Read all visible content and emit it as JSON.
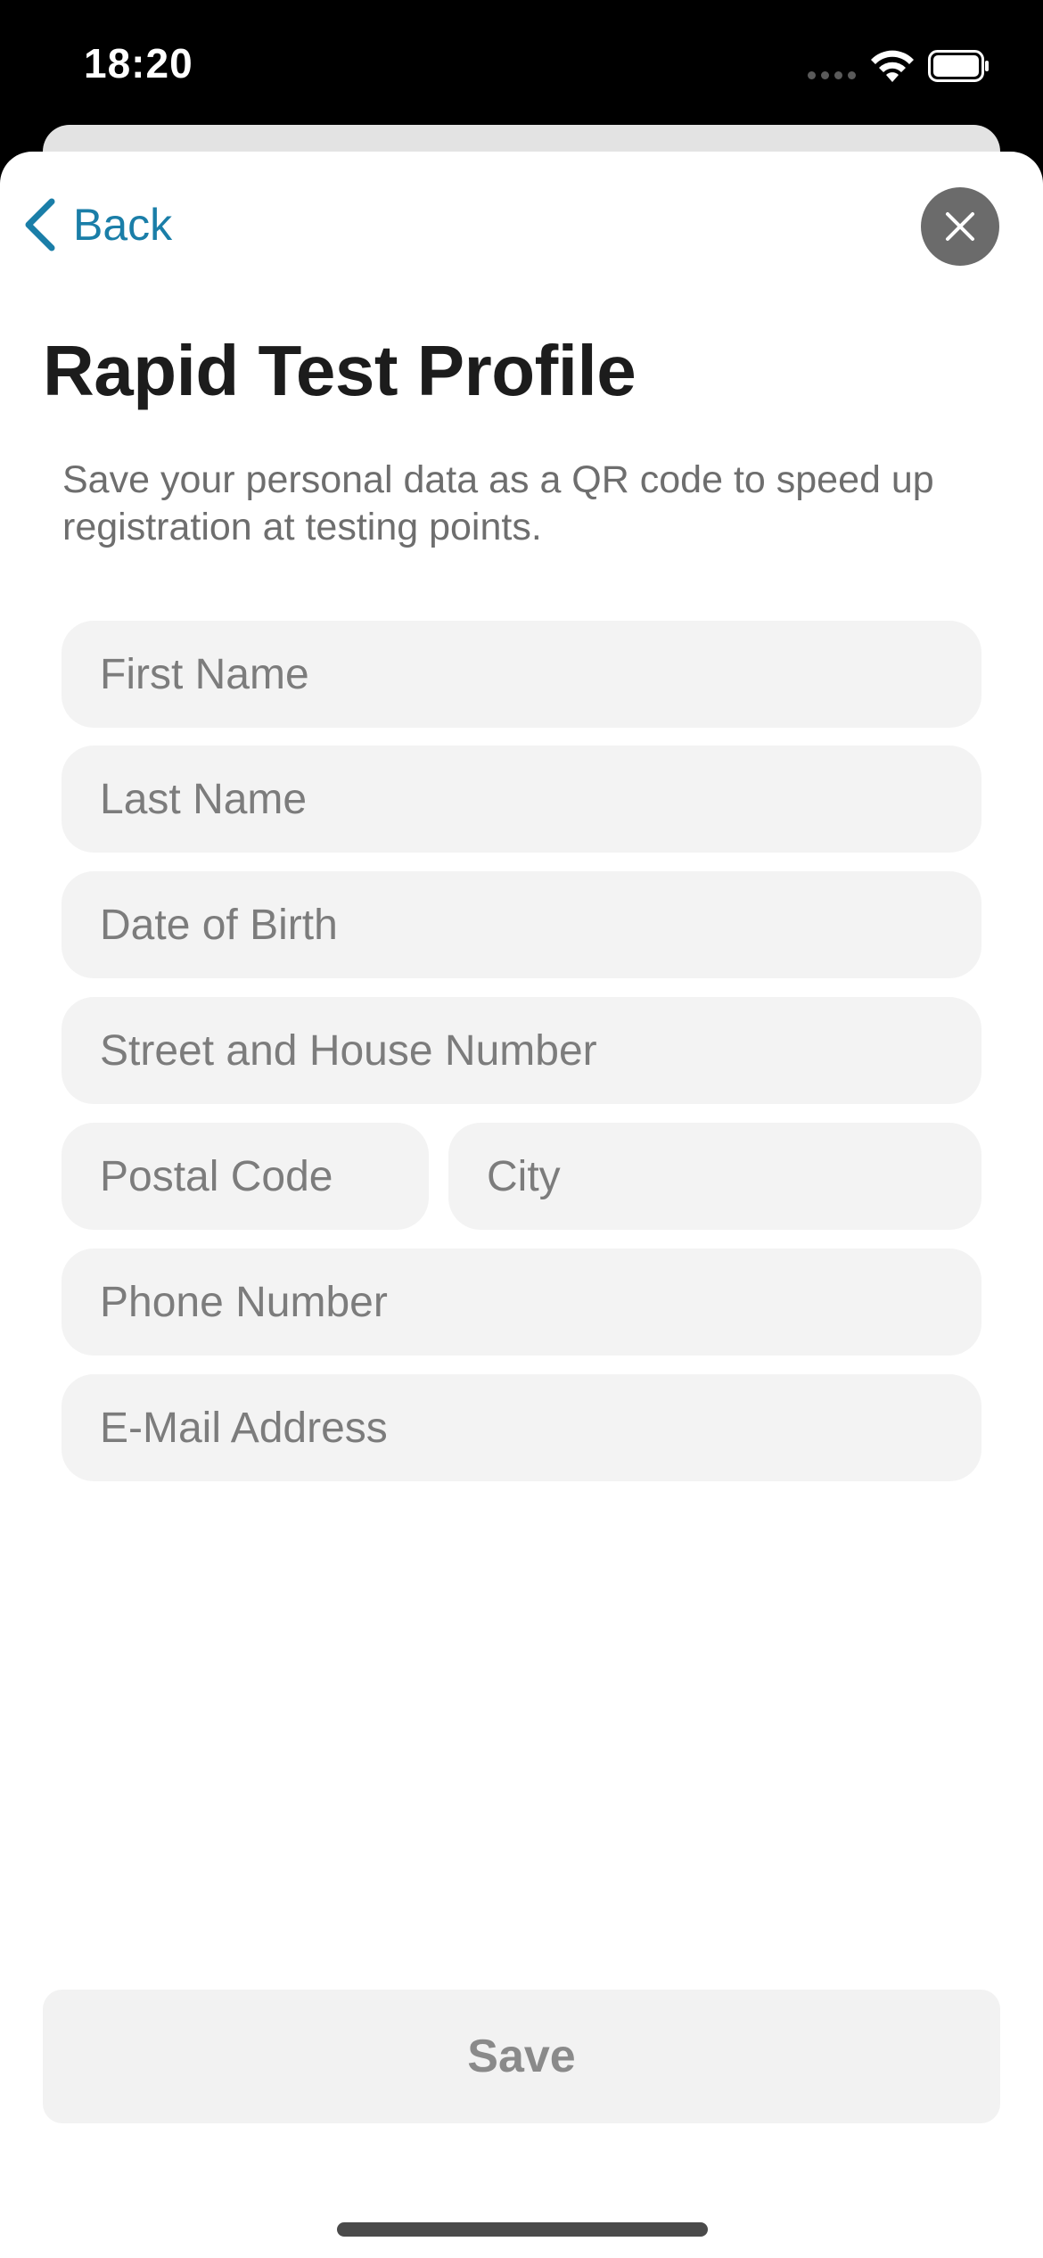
{
  "status_bar": {
    "time": "18:20",
    "icons": [
      "cellular-signal-icon",
      "wifi-icon",
      "battery-icon"
    ]
  },
  "nav": {
    "back_label": "Back",
    "back_icon": "chevron-left-icon",
    "close_icon": "close-icon"
  },
  "page": {
    "title": "Rapid Test Profile",
    "description": "Save your personal data as a QR code to speed up registration at testing points."
  },
  "form": {
    "first_name": {
      "placeholder": "First Name",
      "value": ""
    },
    "last_name": {
      "placeholder": "Last Name",
      "value": ""
    },
    "date_of_birth": {
      "placeholder": "Date of Birth",
      "value": ""
    },
    "street": {
      "placeholder": "Street and House Number",
      "value": ""
    },
    "postal_code": {
      "placeholder": "Postal Code",
      "value": ""
    },
    "city": {
      "placeholder": "City",
      "value": ""
    },
    "phone": {
      "placeholder": "Phone Number",
      "value": ""
    },
    "email": {
      "placeholder": "E-Mail Address",
      "value": ""
    }
  },
  "actions": {
    "save_label": "Save"
  },
  "colors": {
    "accent": "#1a7ea8",
    "field_background": "#f3f3f3",
    "placeholder_text": "#7c7c7c",
    "disabled_button_text": "#8a8a8a"
  }
}
